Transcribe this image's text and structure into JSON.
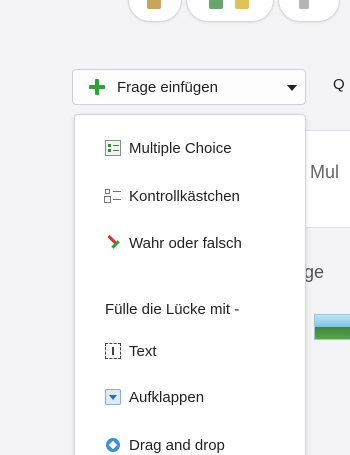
{
  "toolbar": {
    "insert_button_label": "Frage einfügen",
    "next_label_partial": "Q"
  },
  "menu": {
    "items": [
      {
        "label": "Multiple Choice",
        "icon": "multiple-choice-icon"
      },
      {
        "label": "Kontrollkästchen",
        "icon": "checkbox-list-icon"
      },
      {
        "label": "Wahr oder falsch",
        "icon": "true-false-icon"
      }
    ],
    "section_label": "Fülle die Lücke mit -",
    "fill_items": [
      {
        "label": "Text",
        "icon": "text-field-icon"
      },
      {
        "label": "Aufklappen",
        "icon": "dropdown-icon"
      },
      {
        "label": "Drag and drop",
        "icon": "drag-drop-icon"
      }
    ]
  },
  "background": {
    "partial_text_1": "Mul",
    "partial_text_2": "ge"
  },
  "colors": {
    "accent_green": "#2fa33a",
    "accent_red": "#d93025",
    "accent_blue": "#3f8fd6"
  }
}
